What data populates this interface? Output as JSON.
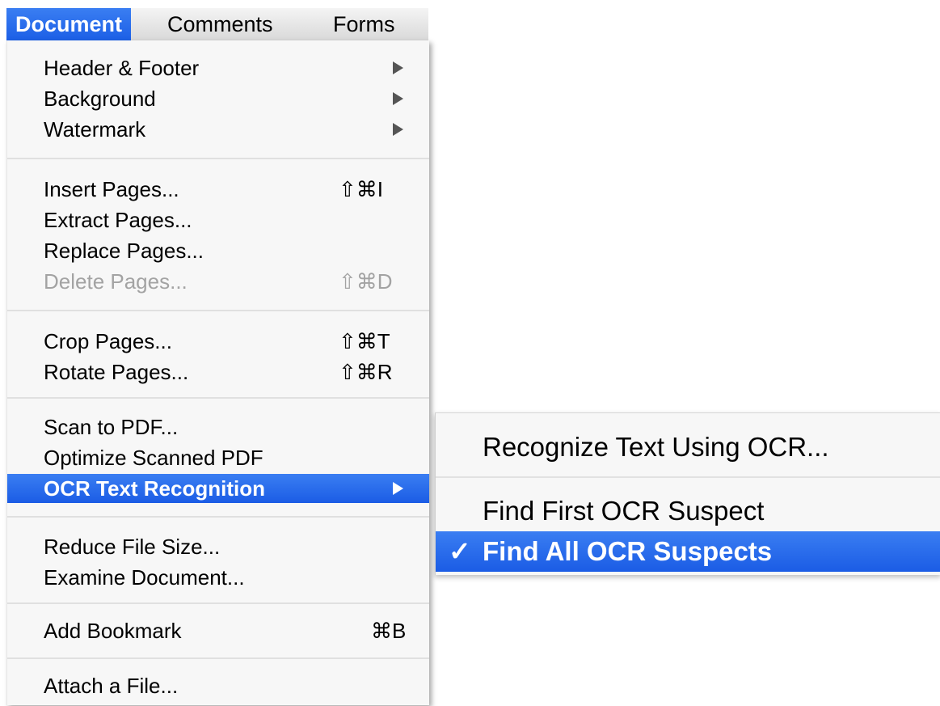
{
  "menubar": {
    "items": [
      {
        "label": "Document"
      },
      {
        "label": "Comments"
      },
      {
        "label": "Forms"
      }
    ]
  },
  "document_menu": {
    "items": [
      {
        "label": "Header & Footer"
      },
      {
        "label": "Background"
      },
      {
        "label": "Watermark"
      },
      {
        "label": "Insert Pages...",
        "shortcut": "⇧⌘I"
      },
      {
        "label": "Extract Pages..."
      },
      {
        "label": "Replace Pages..."
      },
      {
        "label": "Delete Pages...",
        "shortcut": "⇧⌘D",
        "disabled": true
      },
      {
        "label": "Crop Pages...",
        "shortcut": "⇧⌘T"
      },
      {
        "label": "Rotate Pages...",
        "shortcut": "⇧⌘R"
      },
      {
        "label": "Scan to PDF..."
      },
      {
        "label": "Optimize Scanned PDF"
      },
      {
        "label": "OCR Text Recognition"
      },
      {
        "label": "Reduce File Size..."
      },
      {
        "label": "Examine Document..."
      },
      {
        "label": "Add Bookmark",
        "shortcut": "⌘B"
      },
      {
        "label": "Attach a File..."
      }
    ]
  },
  "ocr_submenu": {
    "items": [
      {
        "label": "Recognize Text Using OCR..."
      },
      {
        "label": "Find First OCR Suspect"
      },
      {
        "label": "Find All OCR Suspects",
        "checkmark": "✓"
      }
    ]
  },
  "colors": {
    "highlight": "#1c5fe6",
    "menu_background": "#f7f7f7",
    "disabled_text": "#a3a3a3"
  },
  "icons": [
    "submenu-arrow-icon",
    "checkmark-icon"
  ]
}
